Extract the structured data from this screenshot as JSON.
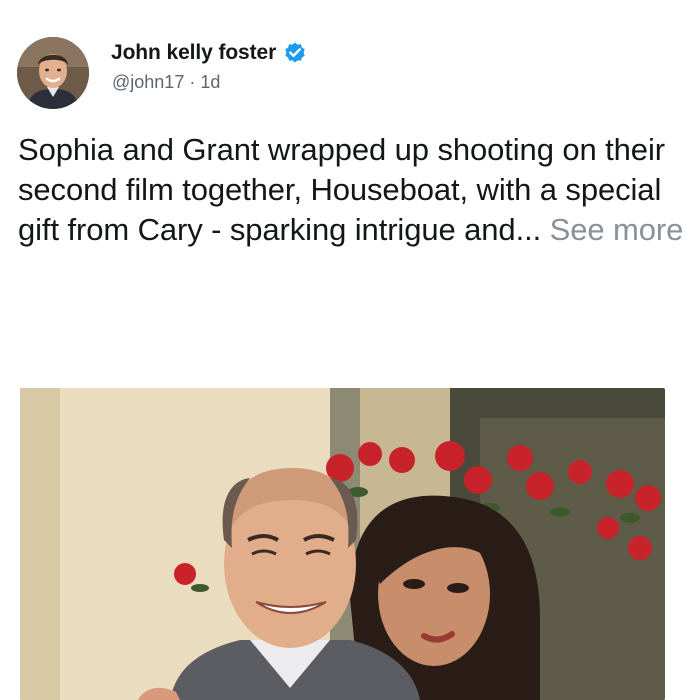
{
  "tweet": {
    "author": {
      "display_name": "John kelly foster",
      "handle": "@john17",
      "separator": "·",
      "time_ago": "1d",
      "verified": true,
      "avatar_icon": "profile-photo"
    },
    "text": "Sophia and Grant wrapped up shooting on their second film together, Houseboat, with a special gift from Cary - sparking intrigue and...",
    "see_more_label": "See more",
    "media_icon": "photo-man-and-woman-with-red-roses"
  },
  "colors": {
    "verified_badge": "#1d9bf0",
    "see_more": "#8a9199",
    "meta_text": "#5b6670"
  }
}
